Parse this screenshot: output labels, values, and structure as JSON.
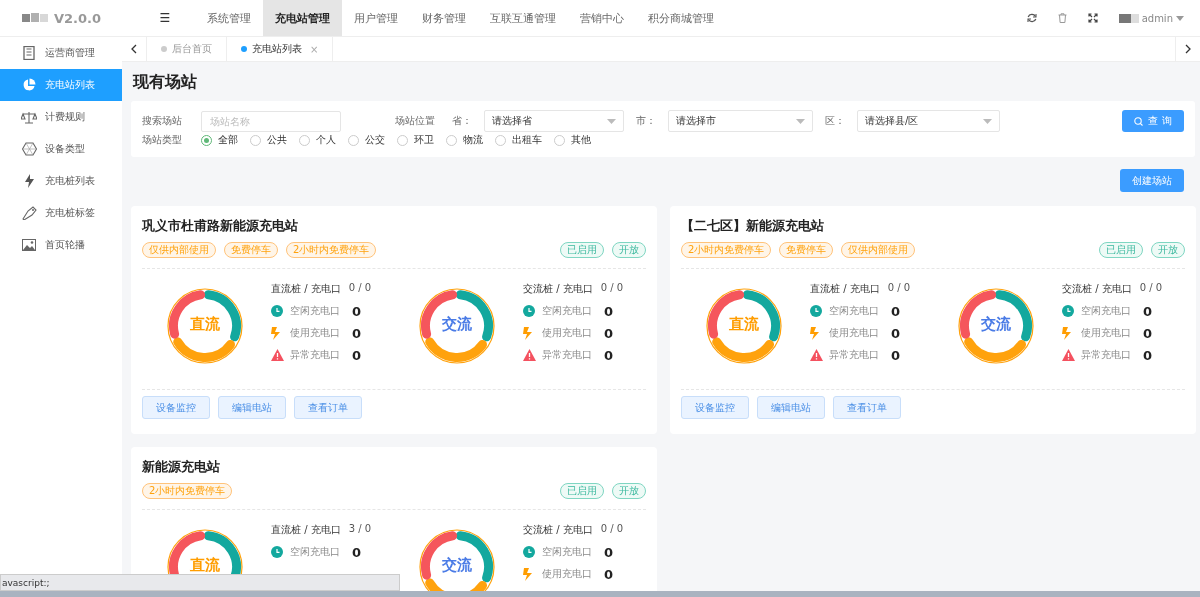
{
  "header": {
    "version": "V2.0.0",
    "menu_icon": "☰",
    "nav": [
      {
        "label": "系统管理",
        "selected": false
      },
      {
        "label": "充电站管理",
        "selected": true
      },
      {
        "label": "用户管理",
        "selected": false
      },
      {
        "label": "财务管理",
        "selected": false
      },
      {
        "label": "互联互通管理",
        "selected": false
      },
      {
        "label": "营销中心",
        "selected": false
      },
      {
        "label": "积分商城管理",
        "selected": false
      }
    ],
    "user": "admin"
  },
  "sidebar": {
    "items": [
      {
        "label": "运营商管理",
        "selected": false
      },
      {
        "label": "充电站列表",
        "selected": true
      },
      {
        "label": "计费规则",
        "selected": false
      },
      {
        "label": "设备类型",
        "selected": false
      },
      {
        "label": "充电桩列表",
        "selected": false
      },
      {
        "label": "充电桩标签",
        "selected": false
      },
      {
        "label": "首页轮播",
        "selected": false
      }
    ]
  },
  "tabs": [
    {
      "label": "后台首页",
      "selected": false
    },
    {
      "label": "充电站列表",
      "selected": true,
      "close": "×"
    }
  ],
  "page_title": "现有场站",
  "filters": {
    "search_label": "搜索场站",
    "search_placeholder": "场站名称",
    "location_label": "场站位置",
    "selects": [
      {
        "label": "省：",
        "value": "请选择省"
      },
      {
        "label": "市：",
        "value": "请选择市"
      },
      {
        "label": "区：",
        "value": "请选择县/区"
      }
    ],
    "query_button": "查 询",
    "type_label": "场站类型",
    "types": [
      {
        "label": "全部",
        "selected": true
      },
      {
        "label": "公共",
        "selected": false
      },
      {
        "label": "个人",
        "selected": false
      },
      {
        "label": "公交",
        "selected": false
      },
      {
        "label": "环卫",
        "selected": false
      },
      {
        "label": "物流",
        "selected": false
      },
      {
        "label": "出租车",
        "selected": false
      },
      {
        "label": "其他",
        "selected": false
      }
    ]
  },
  "create_button": "创建场站",
  "stations": [
    {
      "name": "巩义市杜甫路新能源充电站",
      "tags": [
        "仅供内部使用",
        "免费停车",
        "2小时内免费停车"
      ],
      "status_tags": [
        "已启用",
        "开放"
      ],
      "groups": [
        {
          "kind": "dc",
          "label": "直流",
          "title": "直流桩 / 充电口",
          "count": "0 / 0",
          "rows": [
            {
              "kind": "idle",
              "label": "空闲充电口",
              "value": "0"
            },
            {
              "kind": "busy",
              "label": "使用充电口",
              "value": "0"
            },
            {
              "kind": "fault",
              "label": "异常充电口",
              "value": "0"
            }
          ]
        },
        {
          "kind": "ac",
          "label": "交流",
          "title": "交流桩 / 充电口",
          "count": "0 / 0",
          "rows": [
            {
              "kind": "idle",
              "label": "空闲充电口",
              "value": "0"
            },
            {
              "kind": "busy",
              "label": "使用充电口",
              "value": "0"
            },
            {
              "kind": "fault",
              "label": "异常充电口",
              "value": "0"
            }
          ]
        }
      ],
      "buttons": [
        "设备监控",
        "编辑电站",
        "查看订单"
      ]
    },
    {
      "name": "【二七区】新能源充电站",
      "tags": [
        "2小时内免费停车",
        "免费停车",
        "仅供内部使用"
      ],
      "status_tags": [
        "已启用",
        "开放"
      ],
      "groups": [
        {
          "kind": "dc",
          "label": "直流",
          "title": "直流桩 / 充电口",
          "count": "0 / 0",
          "rows": [
            {
              "kind": "idle",
              "label": "空闲充电口",
              "value": "0"
            },
            {
              "kind": "busy",
              "label": "使用充电口",
              "value": "0"
            },
            {
              "kind": "fault",
              "label": "异常充电口",
              "value": "0"
            }
          ]
        },
        {
          "kind": "ac",
          "label": "交流",
          "title": "交流桩 / 充电口",
          "count": "0 / 0",
          "rows": [
            {
              "kind": "idle",
              "label": "空闲充电口",
              "value": "0"
            },
            {
              "kind": "busy",
              "label": "使用充电口",
              "value": "0"
            },
            {
              "kind": "fault",
              "label": "异常充电口",
              "value": "0"
            }
          ]
        }
      ],
      "buttons": [
        "设备监控",
        "编辑电站",
        "查看订单"
      ]
    },
    {
      "name": "新能源充电站",
      "tags": [
        "2小时内免费停车"
      ],
      "status_tags": [
        "已启用",
        "开放"
      ],
      "groups": [
        {
          "kind": "dc",
          "label": "直流",
          "title": "直流桩 / 充电口",
          "count": "3 / 0",
          "rows": [
            {
              "kind": "idle",
              "label": "空闲充电口",
              "value": "0"
            }
          ]
        },
        {
          "kind": "ac",
          "label": "交流",
          "title": "交流桩 / 充电口",
          "count": "0 / 0",
          "rows": [
            {
              "kind": "idle",
              "label": "空闲充电口",
              "value": "0"
            },
            {
              "kind": "busy",
              "label": "使用充电口",
              "value": "0"
            }
          ]
        }
      ]
    }
  ],
  "status_link": "avascript:;"
}
